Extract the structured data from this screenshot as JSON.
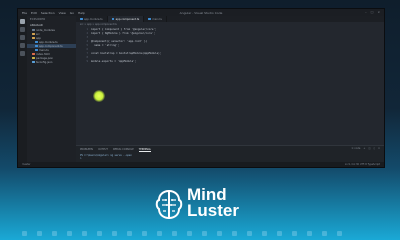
{
  "window": {
    "title": "Angular - Visual Studio Code",
    "menu": [
      "File",
      "Edit",
      "Selection",
      "View",
      "Go",
      "Help"
    ]
  },
  "sidebar": {
    "header": "EXPLORER",
    "project": "ANGULAR",
    "items": [
      {
        "label": "node_modules",
        "color": "#6b7d8f",
        "level": 1
      },
      {
        "label": "src",
        "color": "#d4a451",
        "level": 1
      },
      {
        "label": "app",
        "color": "#d4a451",
        "level": 1
      },
      {
        "label": "app.module.ts",
        "color": "#3f8fd6",
        "level": 2
      },
      {
        "label": "app.component.ts",
        "color": "#3f8fd6",
        "level": 2
      },
      {
        "label": "main.ts",
        "color": "#3f8fd6",
        "level": 2
      },
      {
        "label": "index.html",
        "color": "#e06c4b",
        "level": 1
      },
      {
        "label": "package.json",
        "color": "#c9b447",
        "level": 1
      },
      {
        "label": "tsconfig.json",
        "color": "#5aa0d8",
        "level": 1
      }
    ]
  },
  "tabs": [
    {
      "label": "app.module.ts",
      "active": false,
      "color": "#3f8fd6"
    },
    {
      "label": "app.component.ts",
      "active": true,
      "color": "#3f8fd6"
    },
    {
      "label": "main.ts",
      "active": false,
      "color": "#3f8fd6"
    }
  ],
  "breadcrumb": "src > app > app.component.ts",
  "code": [
    {
      "n": "1",
      "text": "import { Component } from '@angular/core';"
    },
    {
      "n": "2",
      "text": "import { NgModule } from '@angular/core';"
    },
    {
      "n": "3",
      "text": ""
    },
    {
      "n": "4",
      "text": "@Component({ selector: 'app-root' })"
    },
    {
      "n": "5",
      "text": "  name = 'string';"
    },
    {
      "n": "6",
      "text": ""
    },
    {
      "n": "7",
      "text": "const bootstrap = bootstrapModule(AppModule);"
    },
    {
      "n": "8",
      "text": ""
    },
    {
      "n": "9",
      "text": "module.exports = 'AppModule';"
    }
  ],
  "panel": {
    "tabs": [
      "PROBLEMS",
      "OUTPUT",
      "DEBUG CONSOLE",
      "TERMINAL"
    ],
    "active_tab": "TERMINAL",
    "selector": "1: node",
    "terminal_lines": [
      "PS C:\\Users\\Angular> ng serve --open",
      ">"
    ]
  },
  "statusbar": {
    "left": "master",
    "right": "Ln 9, Col 30   UTF-8   TypeScript"
  },
  "brand": {
    "line1": "Mind",
    "line2": "Luster",
    "accent": "#1aa9d6"
  }
}
